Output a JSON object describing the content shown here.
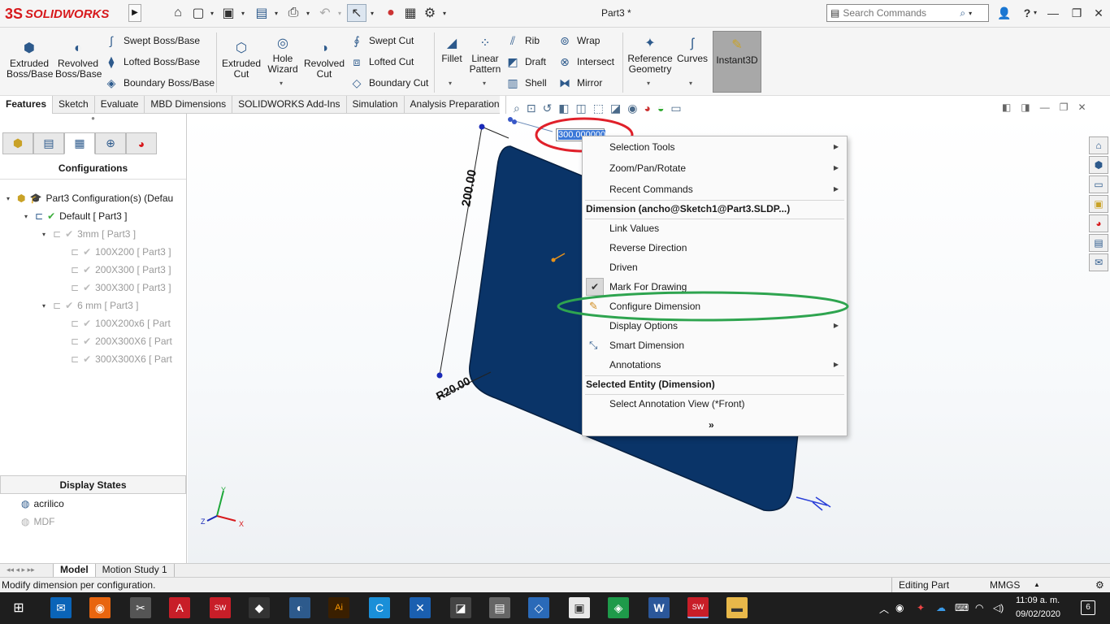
{
  "window": {
    "doc_title": "Part3 *",
    "brand": "SOLIDWORKS",
    "brand_prefix": "3S",
    "search_placeholder": "Search Commands",
    "help_label": "?"
  },
  "ribbon": {
    "extruded_boss": "Extruded Boss/Base",
    "revolved_boss": "Revolved Boss/Base",
    "swept_boss": "Swept Boss/Base",
    "lofted_boss": "Lofted Boss/Base",
    "boundary_boss": "Boundary Boss/Base",
    "extruded_cut": "Extruded Cut",
    "hole_wizard": "Hole Wizard",
    "revolved_cut": "Revolved Cut",
    "swept_cut": "Swept Cut",
    "lofted_cut": "Lofted Cut",
    "boundary_cut": "Boundary Cut",
    "fillet": "Fillet",
    "linear_pattern": "Linear Pattern",
    "rib": "Rib",
    "draft": "Draft",
    "shell": "Shell",
    "wrap": "Wrap",
    "intersect": "Intersect",
    "mirror": "Mirror",
    "reference_geometry": "Reference Geometry",
    "curves": "Curves",
    "instant3d": "Instant3D"
  },
  "tabs": [
    "Features",
    "Sketch",
    "Evaluate",
    "MBD Dimensions",
    "SOLIDWORKS Add-Ins",
    "Simulation",
    "Analysis Preparation"
  ],
  "left_panel": {
    "configurations_title": "Configurations",
    "tree": [
      {
        "label": "Part3 Configuration(s)  (Defau",
        "level": 0,
        "state": "normal"
      },
      {
        "label": "Default [ Part3 ]",
        "level": 1,
        "state": "normal"
      },
      {
        "label": "3mm [ Part3 ]",
        "level": 2,
        "state": "dim"
      },
      {
        "label": "100X200 [ Part3 ]",
        "level": 3,
        "state": "dim"
      },
      {
        "label": "200X300 [ Part3 ]",
        "level": 3,
        "state": "dim"
      },
      {
        "label": "300X300 [ Part3 ]",
        "level": 3,
        "state": "dim"
      },
      {
        "label": "6 mm [ Part3 ]",
        "level": 2,
        "state": "dim"
      },
      {
        "label": "100X200x6 [ Part",
        "level": 3,
        "state": "dim"
      },
      {
        "label": "200X300X6 [ Part",
        "level": 3,
        "state": "dim"
      },
      {
        "label": "300X300X6 [ Part",
        "level": 3,
        "state": "dim"
      }
    ],
    "display_states_title": "Display States",
    "display_states": [
      "acrilico",
      "MDF"
    ]
  },
  "viewport": {
    "dim_vertical": "200.00",
    "dim_radius": "R20.00",
    "dim_edit_value": "300.000000",
    "triad": {
      "x": "X",
      "y": "Y",
      "z": "Z"
    }
  },
  "context_menu": {
    "selection_tools": "Selection Tools",
    "zoom_pan_rotate": "Zoom/Pan/Rotate",
    "recent_commands": "Recent Commands",
    "dimension_header": "Dimension (ancho@Sketch1@Part3.SLDP...)",
    "link_values": "Link Values",
    "reverse_direction": "Reverse Direction",
    "driven": "Driven",
    "mark_for_drawing": "Mark For Drawing",
    "configure_dimension": "Configure Dimension",
    "display_options": "Display Options",
    "smart_dimension": "Smart Dimension",
    "annotations": "Annotations",
    "selected_entity_header": "Selected Entity (Dimension)",
    "select_annotation_view": "Select Annotation View (*Front)",
    "more": "»"
  },
  "bottom_tabs": [
    "Model",
    "Motion Study 1"
  ],
  "status": {
    "message": "Modify dimension per configuration.",
    "mode": "Editing Part",
    "units": "MMGS"
  },
  "taskbar": {
    "time": "11:09 a. m.",
    "date": "09/02/2020",
    "notifications": "6"
  },
  "colors": {
    "part_blue": "#0a3468",
    "sw_red": "#d7191c",
    "highlight_red": "#e0202a",
    "highlight_green": "#2ea44f"
  }
}
